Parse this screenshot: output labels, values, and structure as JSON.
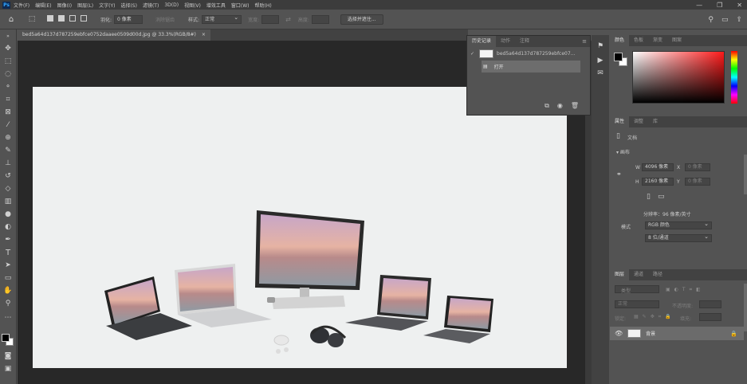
{
  "app": {
    "logo": "Ps"
  },
  "menu": [
    "文件(F)",
    "编辑(E)",
    "图像(I)",
    "图层(L)",
    "文字(Y)",
    "选择(S)",
    "滤镜(T)",
    "3D(D)",
    "视图(V)",
    "增效工具",
    "窗口(W)",
    "帮助(H)"
  ],
  "window_controls": {
    "minimize": "—",
    "maximize": "❐",
    "close": "✕"
  },
  "options": {
    "feather_label": "羽化:",
    "feather_value": "0 像素",
    "antialias_label": "消除锯齿",
    "style_label": "样式:",
    "style_value": "正常",
    "width_label": "宽度:",
    "height_label": "高度:",
    "select_mask_button": "选择并遮住..."
  },
  "document": {
    "tab_title": "bed5a64d137d787259ebfce0752daaee0509d00d.jpg @ 33.3%(RGB/8#)",
    "tab_close": "×"
  },
  "history_panel": {
    "tabs": [
      "历史记录",
      "动作",
      "注释"
    ],
    "active_tab": "历史记录",
    "snapshot_name": "bed5a64d137d787259ebfce07...",
    "steps": [
      {
        "label": "打开"
      }
    ]
  },
  "color_panel": {
    "tabs": [
      "颜色",
      "色板",
      "渐变",
      "图案"
    ],
    "foreground": "#000000",
    "background": "#ffffff",
    "hue_color": "#ff1a1a"
  },
  "properties_panel": {
    "tabs": [
      "属性",
      "调整",
      "库"
    ],
    "doc_label": "文档",
    "canvas_section": "画布",
    "w_label": "W",
    "w_value": "4096 像素",
    "h_label": "H",
    "h_value": "2160 像素",
    "x_label": "X",
    "x_value": "0 像素",
    "y_label": "Y",
    "y_value": "0 像素",
    "resolution": "分辨率：96 像素/英寸",
    "mode_label": "模式",
    "mode_value": "RGB 颜色",
    "depth_value": "8 位/通道"
  },
  "layers_panel": {
    "tabs": [
      "图层",
      "通道",
      "路径"
    ],
    "filter_label": "类型",
    "blend_mode": "正常",
    "opacity_label": "不透明度:",
    "lock_label": "锁定:",
    "fill_label": "填充:",
    "layer_name": "背景"
  }
}
